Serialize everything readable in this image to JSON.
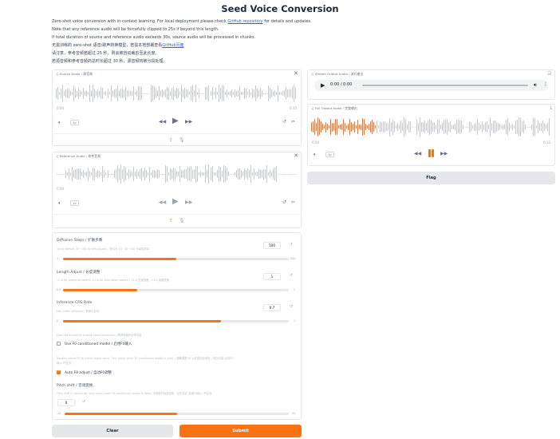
{
  "title": "Seed Voice Conversion",
  "desc": {
    "l1_pre": "Zero-shot voice conversion with in-context learning. For local deployment please check ",
    "l1_link": "GitHub repository",
    "l1_post": " for details and updates.",
    "l2": "Note that any reference audio will be forcefully clipped to 25s if beyond this length.",
    "l3": "If total duration of source and reference audio exceeds 30s, source audio will be processed in chunks.",
    "l4_pre": "无需训练的 zero-shot 语音/歌声转换模型，若需本地部署查看",
    "l4_link": "GitHub页面",
    "l5": "请注意，参考音频若超过 25 秒，则会被自动裁剪至此长度。",
    "l6": "若源音频和参考音频的总时长超过 30 秒，源音频将被分段处理。"
  },
  "source": {
    "label": "Source Audio / 源音频",
    "time_start": "0:00",
    "time_end": "0:15",
    "speed": "1x"
  },
  "reference": {
    "label": "Reference Audio / 参考音频",
    "time_start": "0:00",
    "time_end": "",
    "speed": "1x"
  },
  "stream": {
    "label": "Stream Output Audio / 流式输出",
    "time": "0:00 / 0:00"
  },
  "full": {
    "label": "Full Output Audio / 完整输出",
    "time_start": "0:04",
    "time_end": "0:15",
    "speed": "1x"
  },
  "flag_label": "Flag",
  "diffusion": {
    "label": "Diffusion Steps / 扩散步数",
    "hint": "10 by default, 50~100 for best quality / 默认为 10，50~100 为最佳质量",
    "value": "100",
    "min": "1",
    "max": "200",
    "fraction": 0.5
  },
  "length": {
    "label": "Length Adjust / 长度调整",
    "hint": "<1.0 for speed-up speech, >1.0 for slow-down speech / <1.0 加速语速，>1.0 减慢语速",
    "value": "1",
    "min": "0.5",
    "max": "2",
    "fraction": 0.33
  },
  "cfg": {
    "label": "Inference CFG Rate",
    "hint": "has subtle influence / 有微小影响",
    "value": "0.7",
    "min": "0",
    "max": "1",
    "fraction": 0.7
  },
  "f0_hint": "Must set to true for singing voice conversion / 歌声转换时必须勾选",
  "f0_label": "Use F0 conditioned model / 启用F0输入",
  "autof0_hint": "Roughly adjust F0 to match target voice. Only works when F0 conditioned model is used. / 粗略调整 F0 以匹配目标音色，仅在勾选 '启用F0输入' 时生效",
  "autof0_label": "Auto F0 adjust / 自动F0调整",
  "pitch": {
    "label": "Pitch shift / 音调变换",
    "hint": "Pitch shift in semitones, only works when F0 conditioned model is used / 半音数的音高变换，仅在勾选 '启用F0输入' 时生效",
    "value": "0",
    "min": "-24",
    "max": "24",
    "fraction": 0.5
  },
  "clear_label": "Clear",
  "submit_label": "Submit",
  "colors": {
    "accent": "#f97316",
    "grey_button": "#e5e7eb",
    "wave_grey": "#c4c7cc"
  }
}
